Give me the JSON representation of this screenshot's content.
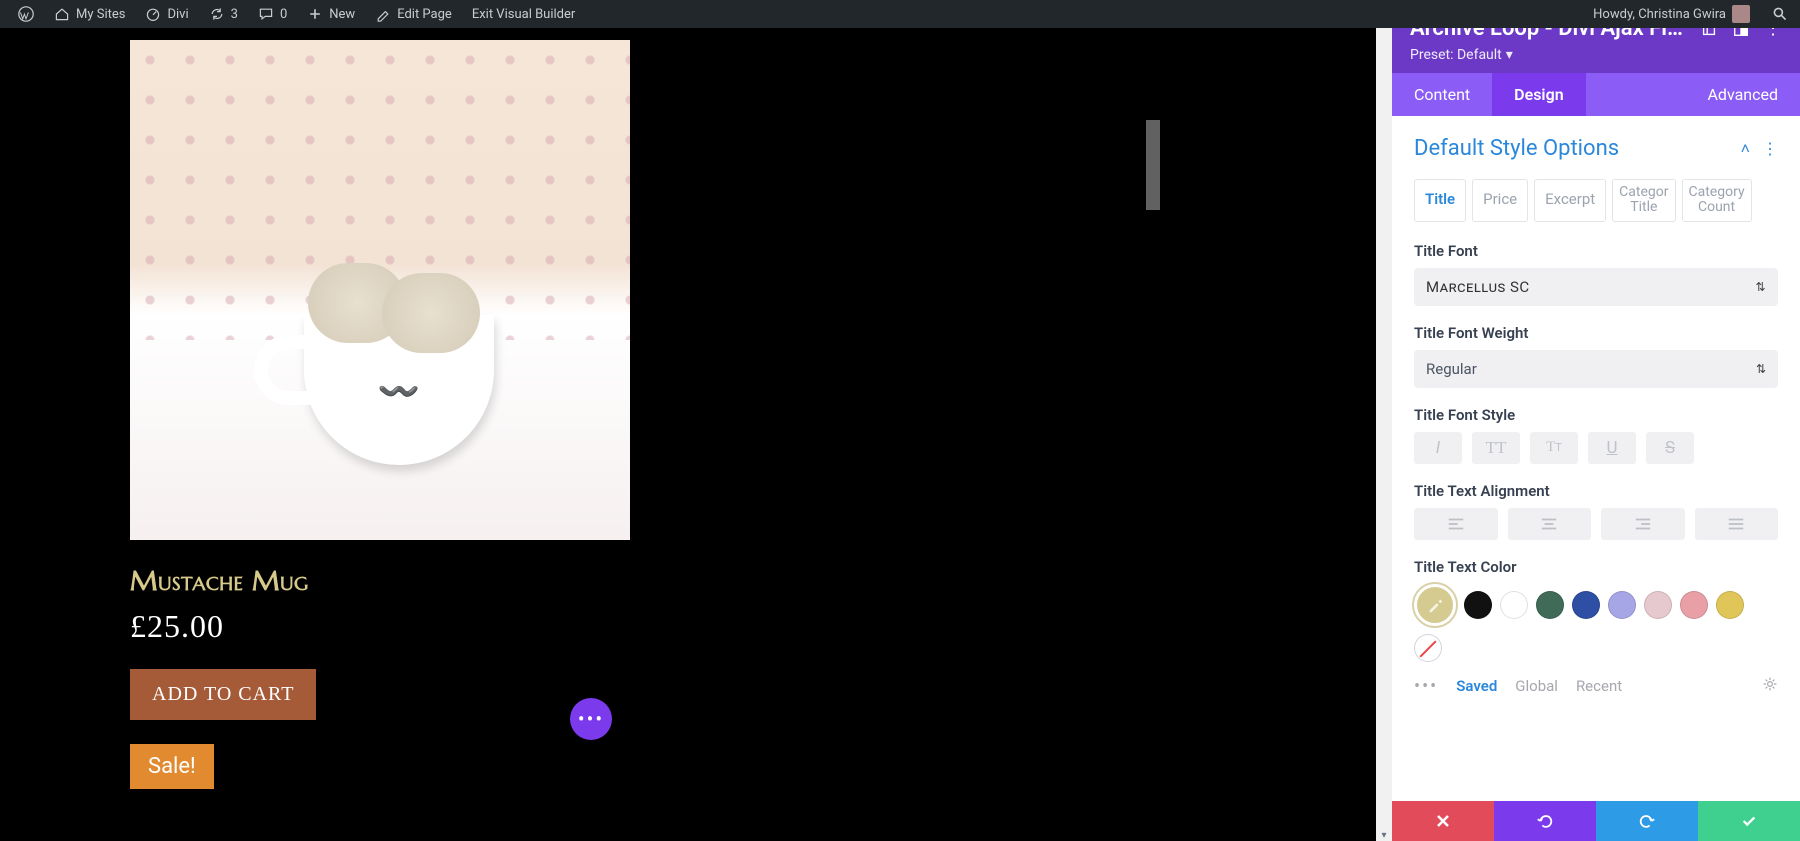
{
  "adminbar": {
    "my_sites": "My Sites",
    "site_name": "Divi",
    "updates_count": "3",
    "comments_count": "0",
    "new_label": "New",
    "edit_page": "Edit Page",
    "exit_vb": "Exit Visual Builder",
    "howdy": "Howdy, Christina Gwira"
  },
  "product": {
    "title": "Mustache Mug",
    "price": "£25.00",
    "add_to_cart": "ADD TO CART",
    "sale_label": "Sale!"
  },
  "panel": {
    "title": "Archive Loop - Divi Ajax Filt...",
    "preset_label": "Preset: Default",
    "tabs": {
      "content": "Content",
      "design": "Design",
      "advanced": "Advanced"
    },
    "section_title": "Default Style Options",
    "subtabs": {
      "title": "Title",
      "price": "Price",
      "excerpt": "Excerpt",
      "cat_title_a": "Categor",
      "cat_title_b": "Title",
      "cat_count_a": "Category",
      "cat_count_b": "Count"
    },
    "labels": {
      "font": "Title Font",
      "font_weight": "Title Font Weight",
      "font_style": "Title Font Style",
      "alignment": "Title Text Alignment",
      "text_color": "Title Text Color"
    },
    "values": {
      "font": "Marcellus SC",
      "font_weight": "Regular"
    },
    "palette_tabs": {
      "saved": "Saved",
      "global": "Global",
      "recent": "Recent"
    },
    "colors": {
      "swatches": [
        "#d5cb90",
        "#111111",
        "#ffffff",
        "#3f6b58",
        "#2e4fa3",
        "#a6a6e6",
        "#e6c9cf",
        "#e8a0a6",
        "#e0c659"
      ]
    }
  }
}
